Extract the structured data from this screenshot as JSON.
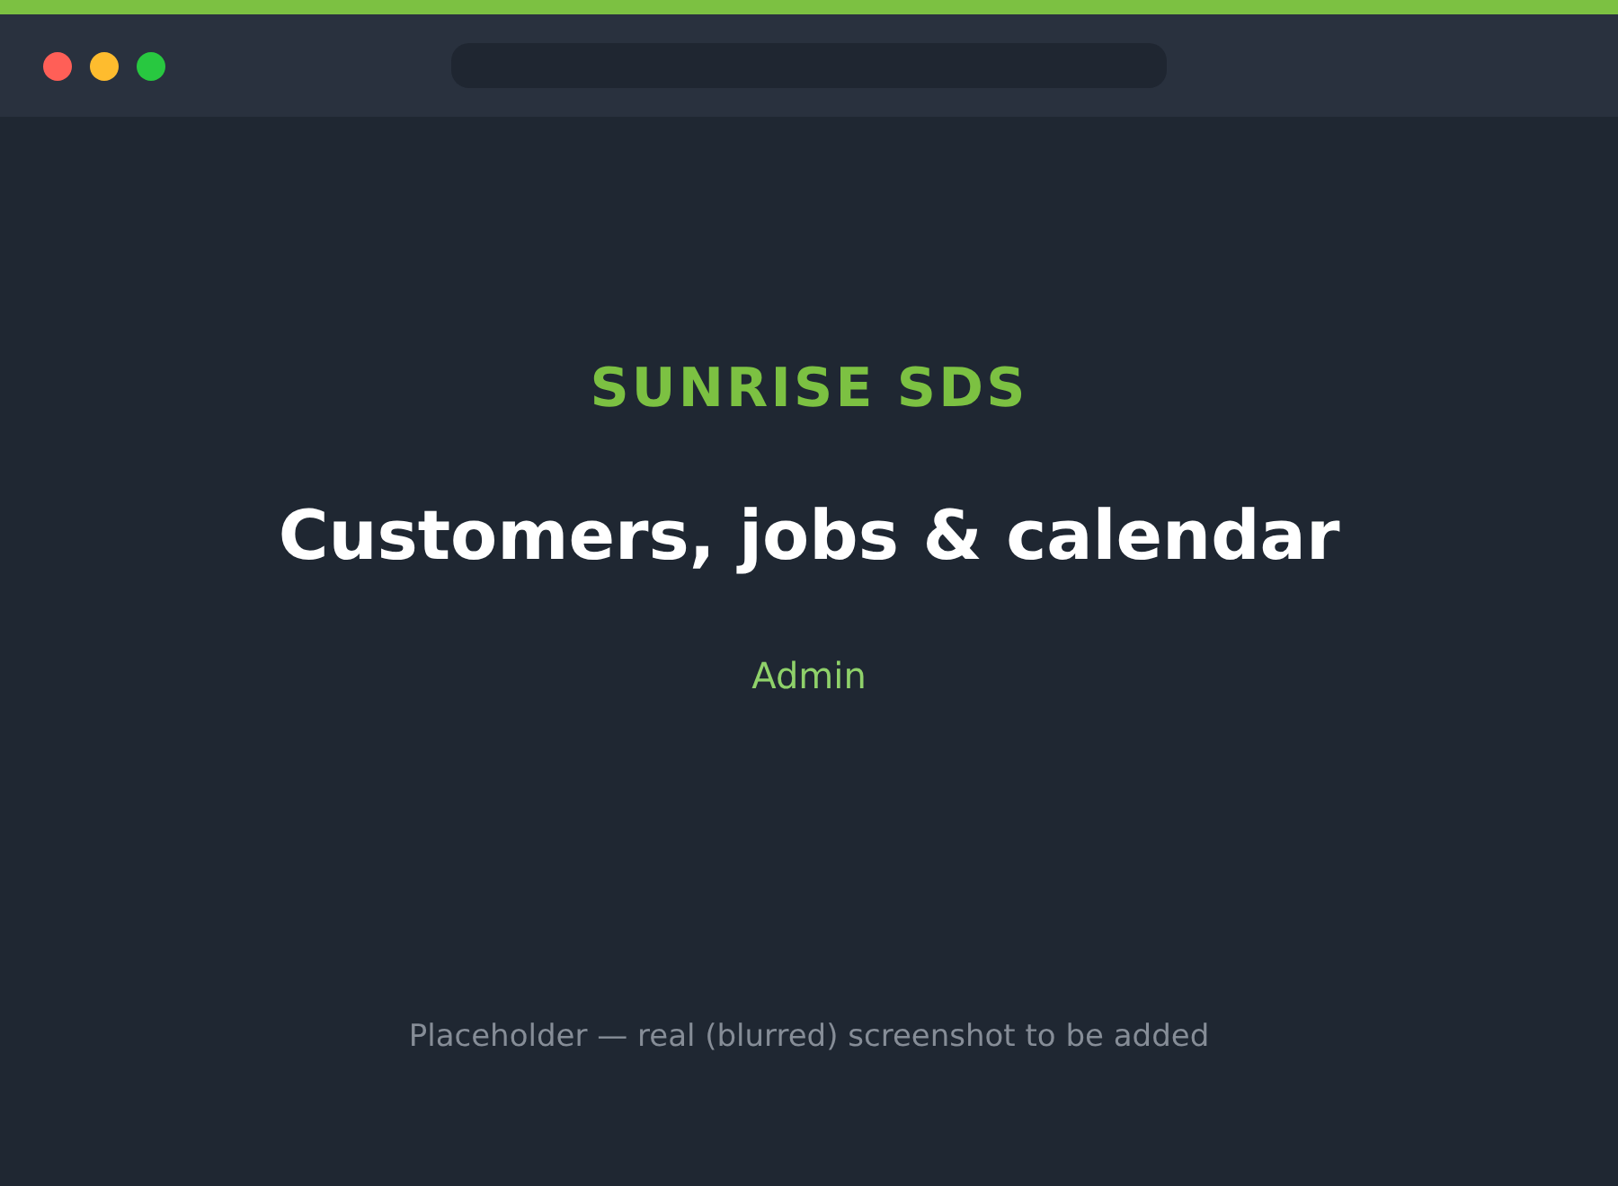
{
  "brand": "SUNRISE SDS",
  "title": "Customers, jobs & calendar",
  "role": "Admin",
  "note": "Placeholder — real (blurred) screenshot to be added"
}
